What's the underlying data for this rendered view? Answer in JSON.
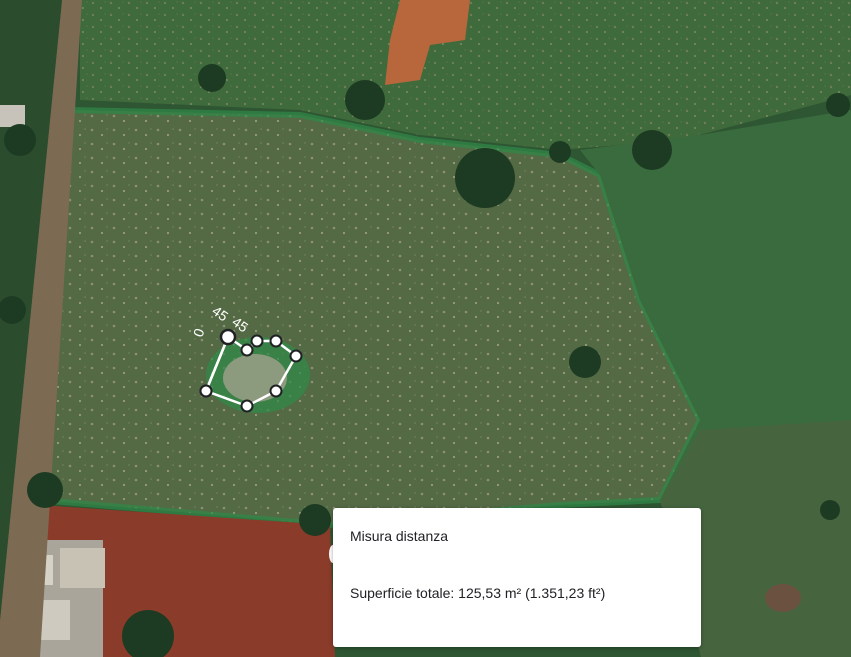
{
  "measure_panel": {
    "title": "Misura distanza",
    "area_text": "Superficie totale: 125,53 m² (1.351,23 ft²)"
  },
  "overlay": {
    "segment_labels": [
      "45",
      "45",
      "0"
    ],
    "vertex_count": 9
  },
  "colors": {
    "measure_line": "#ffffff",
    "vertex_fill": "#ffffff",
    "vertex_stroke": "#202124"
  }
}
